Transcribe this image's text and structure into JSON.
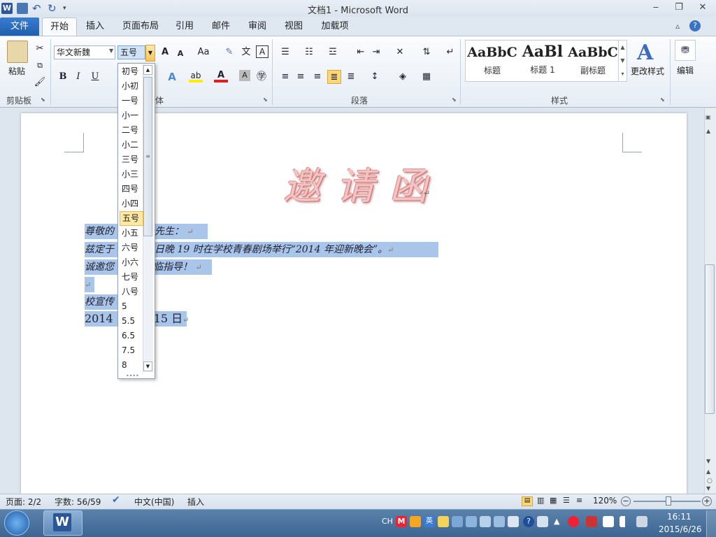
{
  "window": {
    "title": "文档1 - Microsoft Word",
    "min": "‒",
    "max": "❐",
    "close": "✕"
  },
  "tabs": {
    "file": "文件",
    "home": "开始",
    "insert": "插入",
    "layout": "页面布局",
    "references": "引用",
    "mailings": "邮件",
    "review": "审阅",
    "view": "视图",
    "addins": "加载项"
  },
  "ribbon": {
    "clipboard": {
      "label": "剪贴板",
      "paste": "粘贴"
    },
    "font": {
      "label": "体",
      "name": "华文新魏",
      "size": "五号",
      "grow": "A",
      "shrink": "A",
      "aa": "Aa",
      "bold": "B",
      "italic": "I",
      "underline": "U"
    },
    "paragraph": {
      "label": "段落"
    },
    "styles": {
      "label": "样式",
      "items": [
        {
          "sample": "AaBbC",
          "name": "标题"
        },
        {
          "sample": "AaBl",
          "name": "标题 1"
        },
        {
          "sample": "AaBbC",
          "name": "副标题"
        }
      ],
      "change": "更改样式"
    },
    "editing": {
      "label": "编辑"
    }
  },
  "font_size_dropdown": {
    "items": [
      "初号",
      "小初",
      "一号",
      "小一",
      "二号",
      "小二",
      "三号",
      "小三",
      "四号",
      "小四",
      "五号",
      "小五",
      "六号",
      "小六",
      "七号",
      "八号",
      "5",
      "5.5",
      "6.5",
      "7.5",
      "8"
    ],
    "selected": "五号"
  },
  "document": {
    "heading": "邀请函",
    "heading_mark": "↵",
    "lines": [
      {
        "text": "尊敬的",
        "text2": "先生：",
        "mark": "↵"
      },
      {
        "text": "兹定于",
        "text2": "日晚 19 时在学校青春剧场举行“2014 年迎新晚会”。",
        "mark": "↵"
      },
      {
        "text": "诚邀您",
        "text2": "临指导！",
        "mark": "↵"
      },
      {
        "text": "",
        "text2": "",
        "mark": "↵"
      },
      {
        "text": "校宣传",
        "text2": "",
        "mark": ""
      },
      {
        "text": "2014",
        "text2": "15 日",
        "mark": "↵"
      }
    ]
  },
  "status": {
    "page": "页面: 2/2",
    "words": "字数: 56/59",
    "lang": "中文(中国)",
    "mode": "插入",
    "zoom": "120%"
  },
  "taskbar": {
    "lang": "CH",
    "time": "16:11",
    "date": "2015/6/26"
  }
}
